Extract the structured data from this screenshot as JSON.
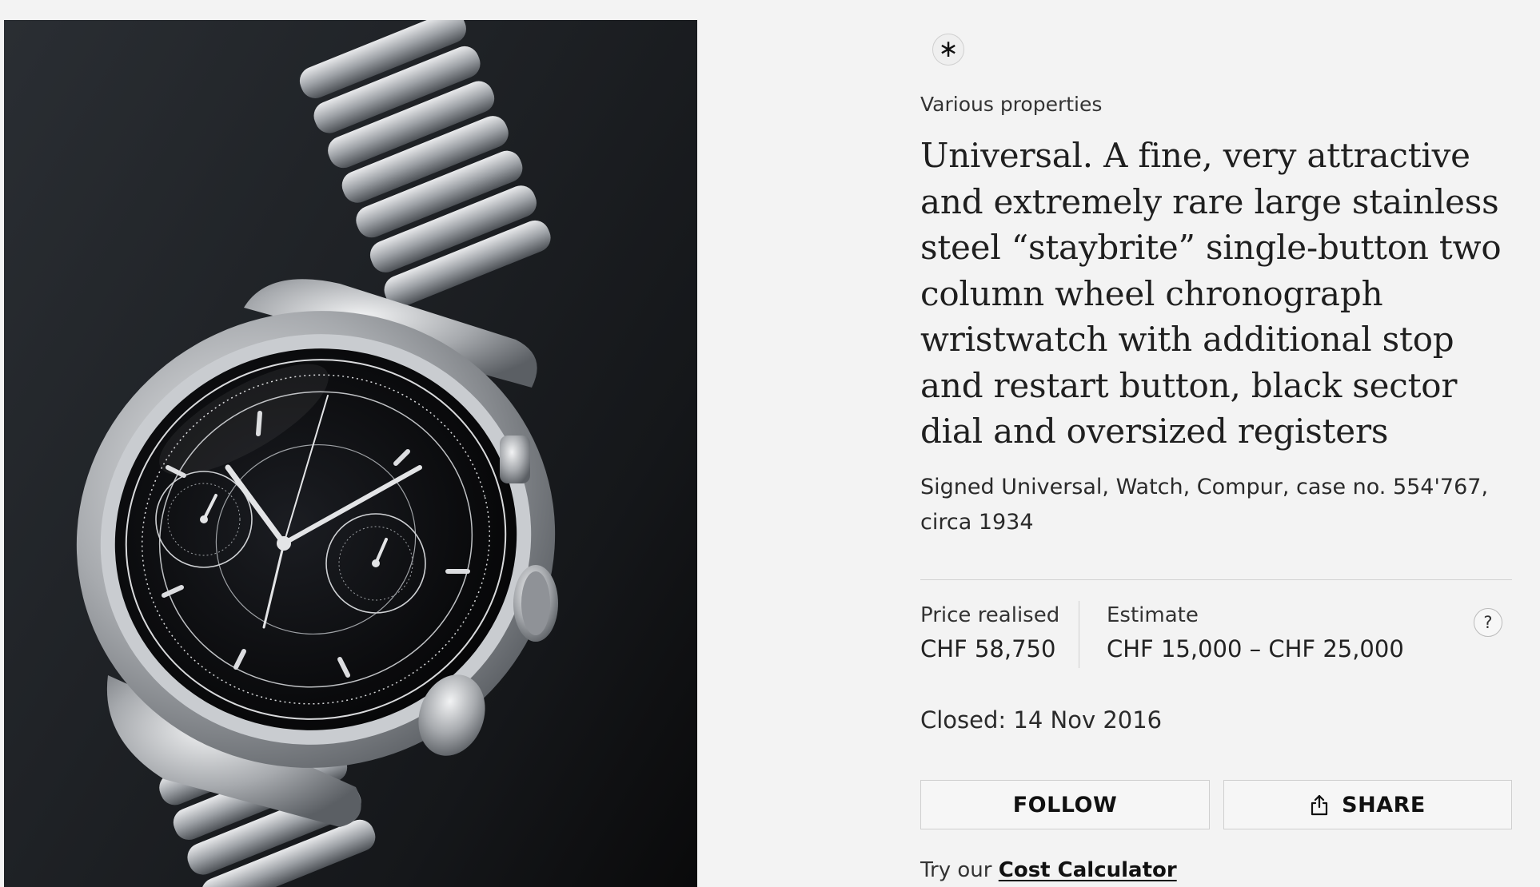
{
  "lot": {
    "badge_icon": "asterisk-icon",
    "badge_glyph": "∗",
    "department": "Various properties",
    "title": "Universal. A fine, very attractive and extremely rare large stainless steel “staybrite” single-button two column wheel chronograph wristwatch with additional stop and restart button, black sector dial and oversized registers",
    "subtitle": "Signed Universal, Watch, Compur, case no. 554'767, circa 1934"
  },
  "pricing": {
    "price_label": "Price realised",
    "price_value": "CHF 58,750",
    "estimate_label": "Estimate",
    "estimate_value": "CHF 15,000 – CHF 25,000",
    "help_glyph": "?"
  },
  "status": {
    "closed_text": "Closed: 14 Nov 2016"
  },
  "actions": {
    "follow_label": "FOLLOW",
    "share_label": "SHARE",
    "share_icon": "share-icon"
  },
  "cost": {
    "prefix": "Try our",
    "link_label": "Cost Calculator"
  },
  "colors": {
    "page_background": "#f3f3f3",
    "dial_black": "#0b0c0f",
    "steel": "#b9bcc0"
  }
}
